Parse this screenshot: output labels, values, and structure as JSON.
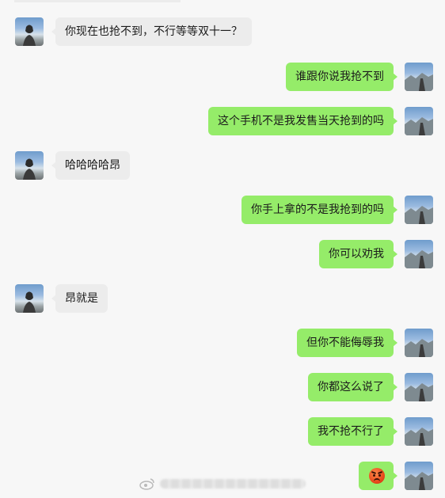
{
  "messages": [
    {
      "side": "left",
      "text": "你现在也抢不到，不行等等双十一？"
    },
    {
      "side": "right",
      "text": "谁跟你说我抢不到"
    },
    {
      "side": "right",
      "text": "这个手机不是我发售当天抢到的吗"
    },
    {
      "side": "left",
      "text": "哈哈哈哈昂"
    },
    {
      "side": "right",
      "text": "你手上拿的不是我抢到的吗"
    },
    {
      "side": "right",
      "text": "你可以劝我"
    },
    {
      "side": "left",
      "text": "昂就是"
    },
    {
      "side": "right",
      "text": "但你不能侮辱我"
    },
    {
      "side": "right",
      "text": "你都这么说了"
    },
    {
      "side": "right",
      "text": "我不抢不行了"
    },
    {
      "side": "right",
      "emoji": "angry-face-icon"
    }
  ],
  "colors": {
    "background": "#f7f7f7",
    "left_bubble": "#ececec",
    "right_bubble": "#95ec69"
  }
}
